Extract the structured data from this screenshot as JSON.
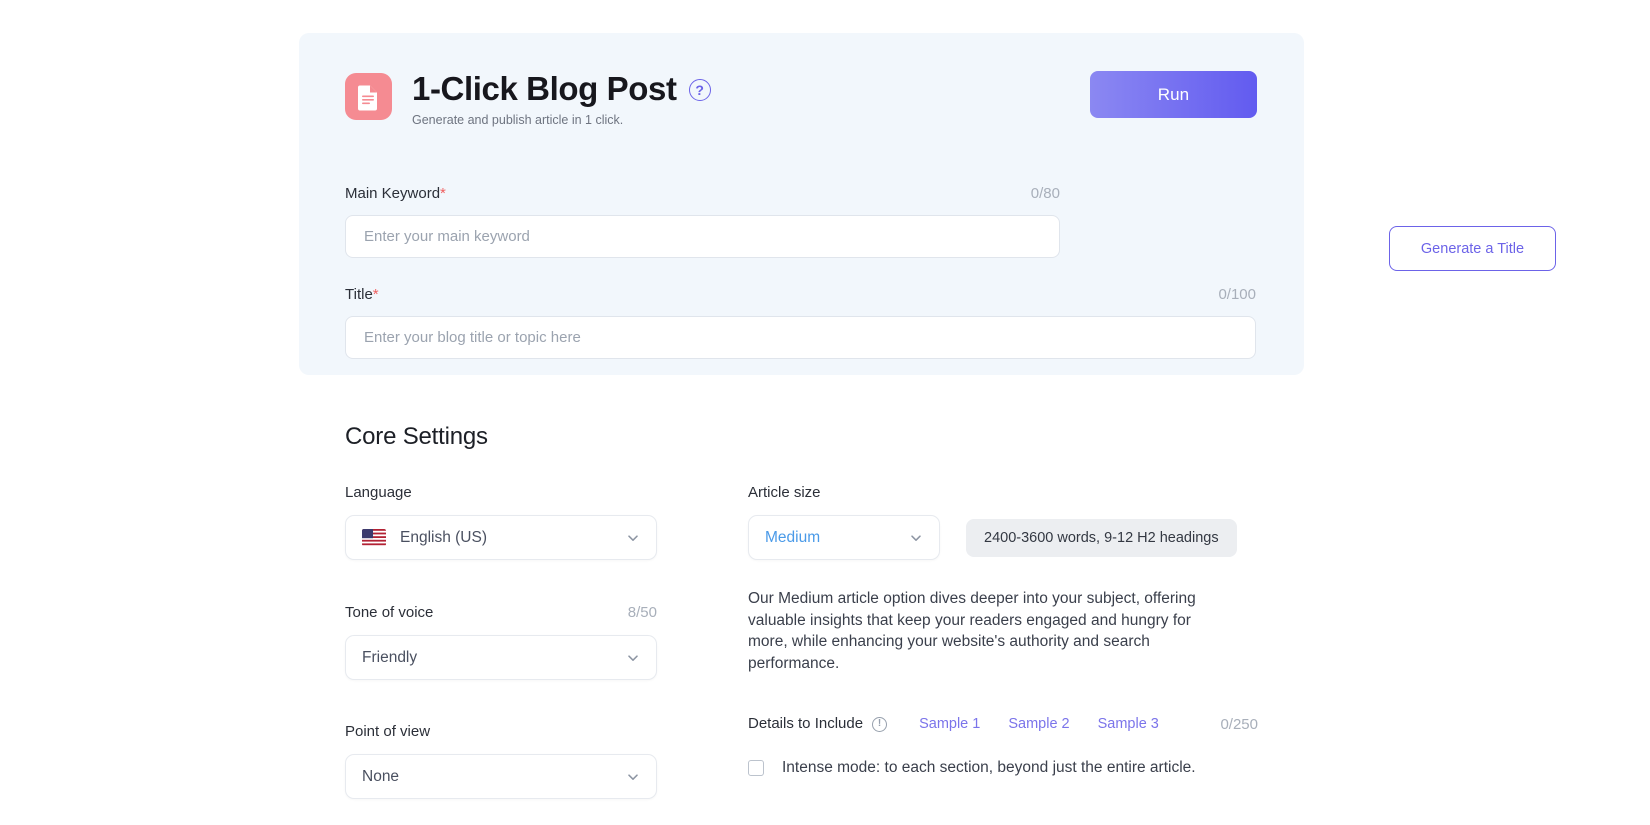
{
  "hero": {
    "icon_name": "document-icon",
    "title": "1-Click Blog Post",
    "subtitle": "Generate and publish article in 1 click.",
    "help_glyph": "?",
    "run_label": "Run"
  },
  "main_keyword": {
    "label": "Main Keyword",
    "required_mark": "*",
    "counter": "0/80",
    "placeholder": "Enter your main keyword",
    "value": ""
  },
  "generate_title": {
    "label": "Generate a Title"
  },
  "title_field": {
    "label": "Title",
    "required_mark": "*",
    "counter": "0/100",
    "placeholder": "Enter your blog title or topic here",
    "value": ""
  },
  "core_settings": {
    "heading": "Core Settings",
    "language": {
      "label": "Language",
      "value": "English (US)",
      "flag": "us-flag-icon"
    },
    "tone_of_voice": {
      "label": "Tone of voice",
      "counter": "8/50",
      "value": "Friendly"
    },
    "point_of_view": {
      "label": "Point of view",
      "value": "None"
    },
    "article_size": {
      "label": "Article size",
      "value": "Medium",
      "badge": "2400-3600 words, 9-12 H2 headings",
      "description": "Our Medium article option dives deeper into your subject, offering valuable insights that keep your readers engaged and hungry for more, while enhancing your website's authority and search performance."
    },
    "details_to_include": {
      "label": "Details to Include",
      "info_glyph": "!",
      "samples": [
        "Sample 1",
        "Sample 2",
        "Sample 3"
      ],
      "counter": "0/250",
      "intense_mode_label": "Intense mode: to each section, beyond just the entire article.",
      "intense_mode_checked": false
    }
  },
  "colors": {
    "accent": "#6c63e8",
    "icon_bg": "#f58b92",
    "hero_bg": "#f2f7fc",
    "link": "#7b74ea",
    "medium_value": "#4a9ae8",
    "required": "#f06060"
  }
}
